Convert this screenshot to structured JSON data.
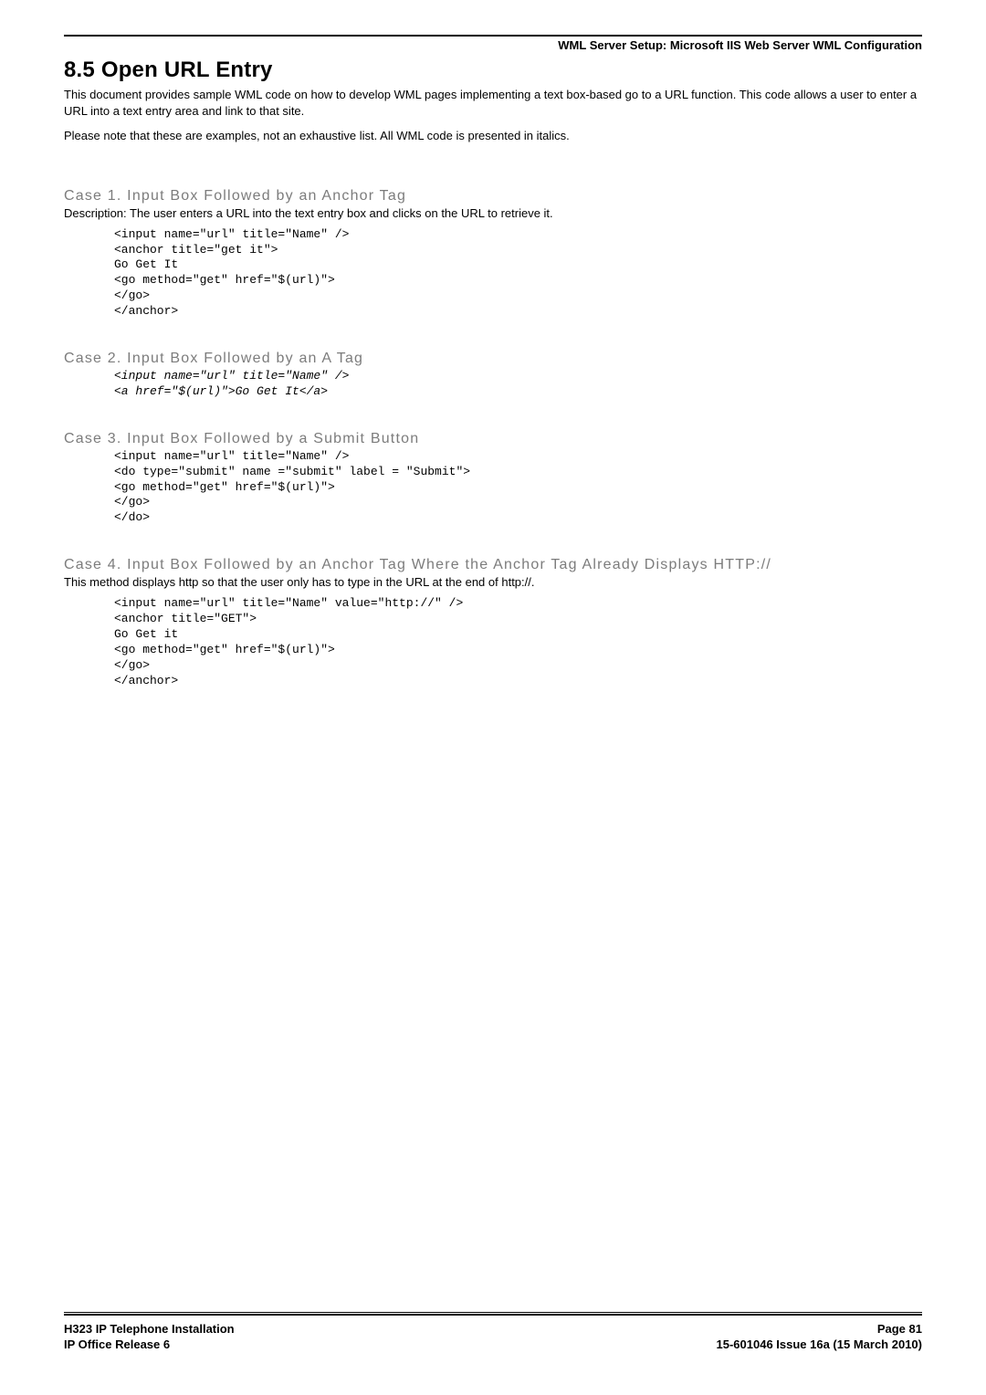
{
  "header": {
    "running": "WML Server Setup: Microsoft IIS Web Server WML Configuration"
  },
  "title": "8.5 Open URL Entry",
  "intro1": "This document provides sample WML code on how to develop WML pages implementing a text box-based go to a URL function. This code allows a user to enter a URL into a text entry area and link to that site.",
  "intro2": "Please note that these are examples, not an exhaustive list. All WML code is presented in italics.",
  "case1": {
    "heading": "Case 1. Input Box Followed by an Anchor Tag",
    "desc": "Description: The user enters a URL into the text entry box and clicks on the URL to retrieve it.",
    "code": "<input name=\"url\" title=\"Name\" />\n<anchor title=\"get it\">\nGo Get It\n<go method=\"get\" href=\"$(url)\">\n</go>\n</anchor>"
  },
  "case2": {
    "heading": "Case 2. Input Box Followed by an A Tag",
    "code": "<input name=\"url\" title=\"Name\" />\n<a href=\"$(url)\">Go Get It</a>"
  },
  "case3": {
    "heading": "Case 3. Input Box Followed by a Submit Button",
    "code": "<input name=\"url\" title=\"Name\" />\n<do type=\"submit\" name =\"submit\" label = \"Submit\">\n<go method=\"get\" href=\"$(url)\">\n</go>\n</do>"
  },
  "case4": {
    "heading": "Case 4. Input Box Followed by an Anchor Tag Where the Anchor Tag Already Displays HTTP://",
    "desc": "This method displays http so that the user only has to type in the URL at the end of http://.",
    "code": "<input name=\"url\" title=\"Name\" value=\"http://\" />\n<anchor title=\"GET\">\nGo Get it\n<go method=\"get\" href=\"$(url)\">\n</go>\n</anchor>"
  },
  "footer": {
    "left1": "H323 IP Telephone Installation",
    "right1": "Page 81",
    "left2": "IP Office Release 6",
    "right2": "15-601046 Issue 16a (15 March 2010)"
  }
}
